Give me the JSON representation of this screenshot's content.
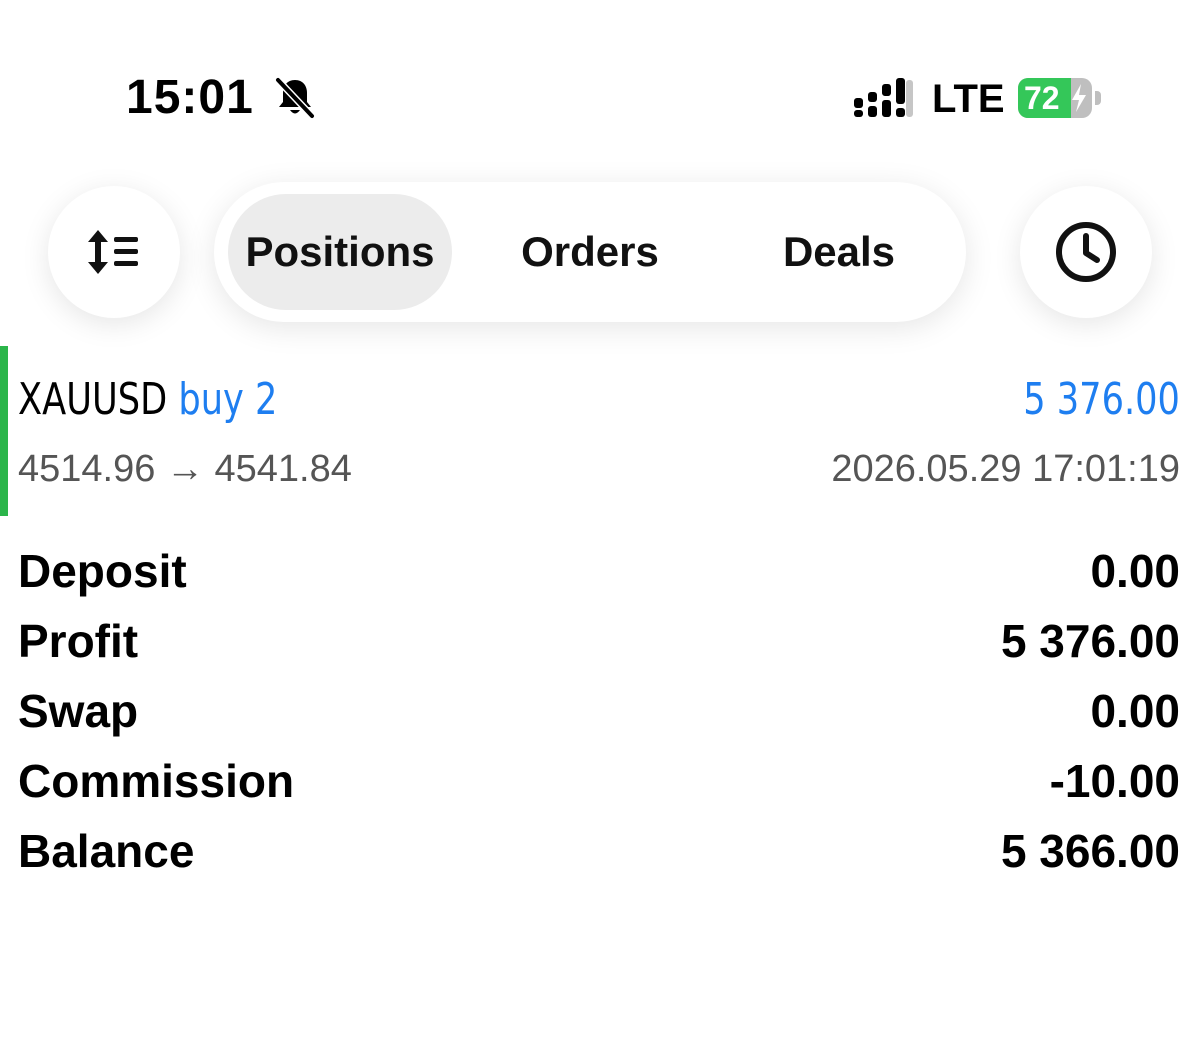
{
  "status_bar": {
    "time": "15:01",
    "network": "LTE",
    "battery_level": "72",
    "battery_fraction": 0.72,
    "icons": [
      "bell-slash-icon",
      "signal-icon",
      "battery-charging-icon"
    ]
  },
  "toolbar": {
    "sort_icon": "sort-list-icon",
    "history_icon": "clock-icon",
    "tabs": [
      {
        "label": "Positions",
        "active": true
      },
      {
        "label": "Orders",
        "active": false
      },
      {
        "label": "Deals",
        "active": false
      }
    ]
  },
  "position": {
    "symbol": "XAUUSD",
    "trade_type": "buy 2",
    "open_price": "4514.96",
    "arrow": "→",
    "close_price": "4541.84",
    "profit": "5 376.00",
    "time": "2026.05.29 17:01:19"
  },
  "summary": [
    {
      "label": "Deposit",
      "value": "0.00"
    },
    {
      "label": "Profit",
      "value": "5 376.00"
    },
    {
      "label": "Swap",
      "value": "0.00"
    },
    {
      "label": "Commission",
      "value": "-10.00"
    },
    {
      "label": "Balance",
      "value": "5 366.00"
    }
  ],
  "colors": {
    "accent_blue": "#1e7ef0",
    "buy_green": "#2bb54a",
    "battery_green": "#34c759",
    "muted_text": "#555555",
    "active_tab_bg": "#ececec"
  }
}
